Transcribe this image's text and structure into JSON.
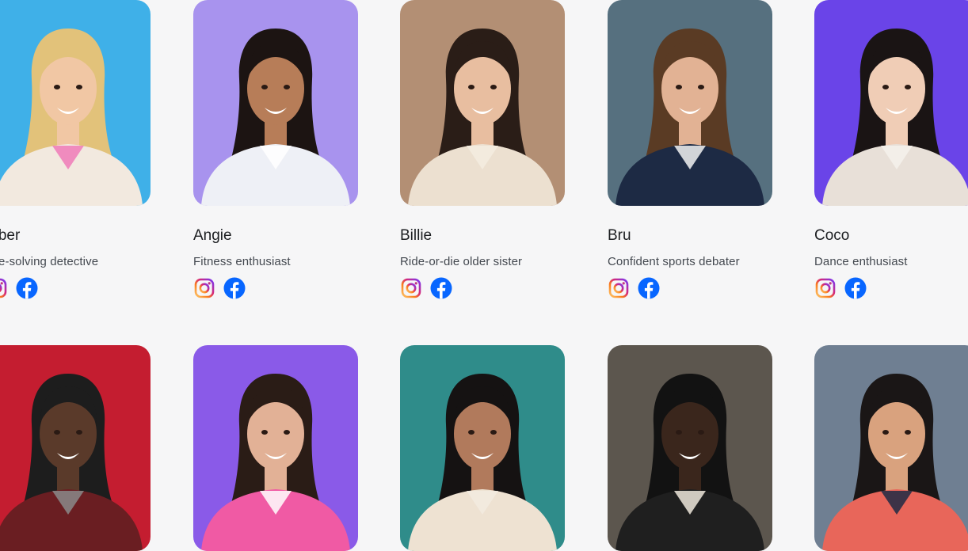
{
  "personas": [
    {
      "name": "mber",
      "description": "ime-solving detective",
      "bg": "#3fb0e8",
      "skin": "#f1c7a4",
      "hair": "#e2c27a",
      "top": "#f2e9df",
      "accent": "#f07ab8"
    },
    {
      "name": "Angie",
      "description": "Fitness enthusiast",
      "bg": "#a893ee",
      "skin": "#b77d58",
      "hair": "#1c1412",
      "top": "#eef0f6",
      "accent": "#ffffff"
    },
    {
      "name": "Billie",
      "description": "Ride-or-die older sister",
      "bg": "#b38f74",
      "skin": "#e8bea0",
      "hair": "#2a1d17",
      "top": "#ece0d0",
      "accent": "#f5ece0"
    },
    {
      "name": "Bru",
      "description": "Confident sports debater",
      "bg": "#56707f",
      "skin": "#e2b294",
      "hair": "#5a3b24",
      "top": "#1d2a44",
      "accent": "#f2f2f2"
    },
    {
      "name": "Coco",
      "description": "Dance enthusiast",
      "bg": "#6a44e8",
      "skin": "#f0cdb6",
      "hair": "#1a1414",
      "top": "#e8e0d8",
      "accent": "#f5f1ec"
    },
    {
      "name": "",
      "description": "",
      "bg": "#c41d30",
      "skin": "#5a3a2a",
      "hair": "#1d1d1d",
      "top": "#6a1e22",
      "accent": "#8a8a8a"
    },
    {
      "name": "",
      "description": "",
      "bg": "#8a5ae8",
      "skin": "#e2b196",
      "hair": "#2a1c16",
      "top": "#f05aa4",
      "accent": "#ffffff"
    },
    {
      "name": "",
      "description": "",
      "bg": "#2f8c8a",
      "skin": "#b17a5c",
      "hair": "#151212",
      "top": "#eee2d2",
      "accent": "#f2ebe0"
    },
    {
      "name": "",
      "description": "",
      "bg": "#5c564e",
      "skin": "#3a261c",
      "hair": "#121212",
      "top": "#1f1f1f",
      "accent": "#efe8dc"
    },
    {
      "name": "",
      "description": "",
      "bg": "#6f7f92",
      "skin": "#d9a27e",
      "hair": "#1a1616",
      "top": "#e8665a",
      "accent": "#1f2a44"
    }
  ],
  "icons": {
    "instagram": "instagram-icon",
    "facebook": "facebook-icon"
  },
  "colors": {
    "facebook_blue": "#0866ff",
    "page_bg": "#f6f6f7"
  }
}
